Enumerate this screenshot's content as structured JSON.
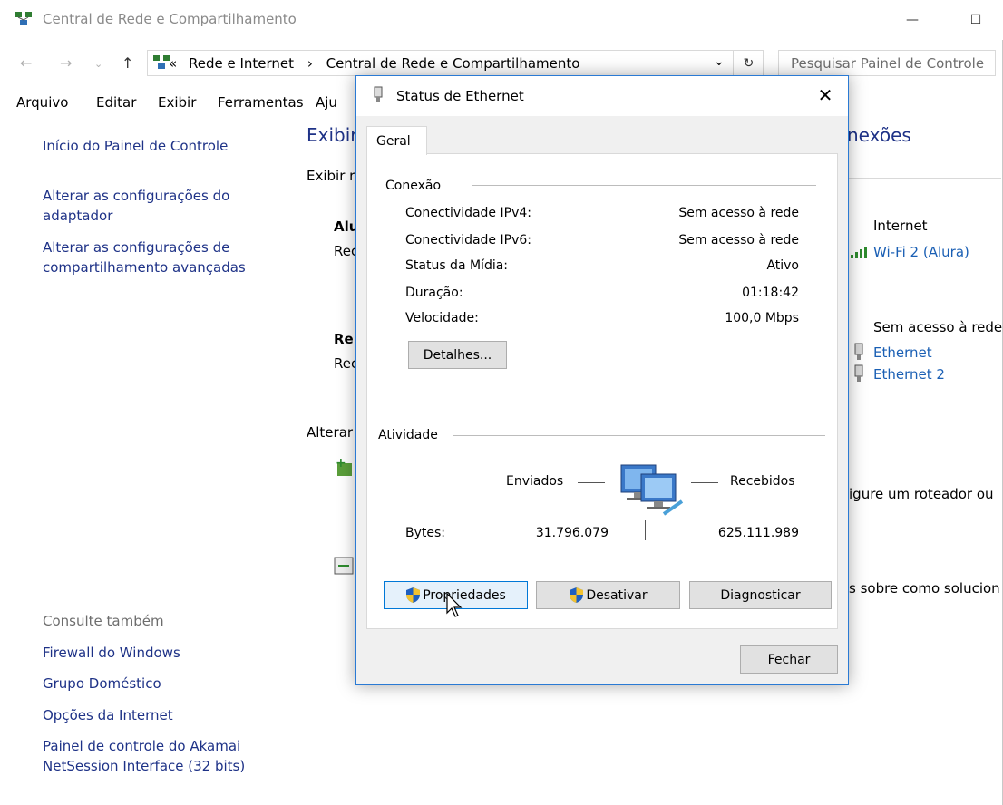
{
  "window": {
    "title": "Central de Rede e Compartilhamento",
    "minimize": "—",
    "maximize": "☐"
  },
  "address": {
    "chevrons": "«",
    "crumb1": "Rede e Internet",
    "separator": "›",
    "crumb2": "Central de Rede e Compartilhamento",
    "dropdown": "⌄",
    "refresh": "↻",
    "search_placeholder": "Pesquisar Painel de Controle"
  },
  "menu": [
    "Arquivo",
    "Editar",
    "Exibir",
    "Ferramentas",
    "Aju"
  ],
  "left_pane": {
    "home": "Início do Painel de Controle",
    "link1": "Alterar as configurações do adaptador",
    "link2": "Alterar as configurações de compartilhamento avançadas",
    "see_also": "Consulte também",
    "also": [
      "Firewall do Windows",
      "Grupo Doméstico",
      "Opções da Internet",
      "Painel de controle do Akamai NetSession Interface (32 bits)"
    ]
  },
  "content_peek": {
    "heading_left": "Exibir",
    "heading_right": "nexões",
    "sub": "Exibir r",
    "net1_name": "Alu",
    "net1_sub": "Rec",
    "net2_name": "Re",
    "net2_sub": "Rec",
    "alter": "Alterar",
    "access1_label": "Internet",
    "access1_link": "Wi-Fi 2 (Alura)",
    "access2_label": "Sem acesso à rede",
    "access2_link1": "Ethernet",
    "access2_link2": "Ethernet 2",
    "router_text": "igure um roteador ou",
    "solve_text": "s sobre como solucion"
  },
  "dialog": {
    "title": "Status de Ethernet",
    "close": "✕",
    "tab": "Geral",
    "conexao_label": "Conexão",
    "rows": [
      {
        "label": "Conectividade IPv4:",
        "value": "Sem acesso à rede"
      },
      {
        "label": "Conectividade IPv6:",
        "value": "Sem acesso à rede"
      },
      {
        "label": "Status da Mídia:",
        "value": "Ativo"
      },
      {
        "label": "Duração:",
        "value": "01:18:42"
      },
      {
        "label": "Velocidade:",
        "value": "100,0 Mbps"
      }
    ],
    "details_button": "Detalhes...",
    "atividade_label": "Atividade",
    "sent_label": "Enviados",
    "received_label": "Recebidos",
    "bytes_label": "Bytes:",
    "bytes_sent": "31.796.079",
    "bytes_received": "625.111.989",
    "properties_button": "Propriedades",
    "disable_button": "Desativar",
    "diagnose_button": "Diagnosticar",
    "close_button": "Fechar"
  },
  "colors": {
    "accent": "#0078d7",
    "link": "#1e3287",
    "border": "#2a7ad4"
  }
}
